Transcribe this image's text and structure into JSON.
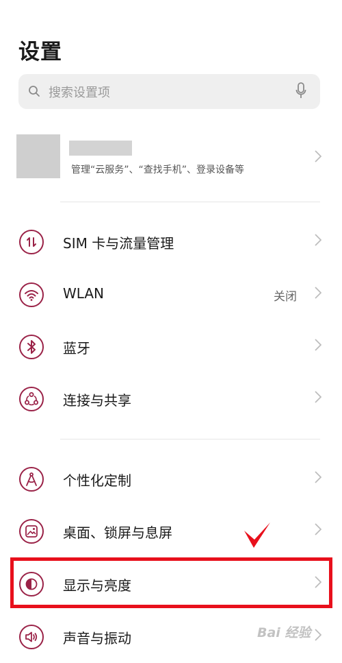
{
  "header": {
    "title": "设置"
  },
  "search": {
    "placeholder": "搜索设置项"
  },
  "account": {
    "subtitle": "管理“云服务”、“查找手机”、登录设备等"
  },
  "items": [
    {
      "label": "SIM 卡与流量管理",
      "icon": "sim-traffic-icon"
    },
    {
      "label": "WLAN",
      "value": "关闭",
      "icon": "wifi-icon"
    },
    {
      "label": "蓝牙",
      "icon": "bluetooth-icon"
    },
    {
      "label": "连接与共享",
      "icon": "share-icon"
    },
    {
      "label": "个性化定制",
      "icon": "personalize-icon"
    },
    {
      "label": "桌面、锁屏与息屏",
      "icon": "wallpaper-icon"
    },
    {
      "label": "显示与亮度",
      "icon": "display-icon"
    },
    {
      "label": "声音与振动",
      "icon": "sound-icon"
    }
  ],
  "watermark": {
    "text": "Bai 经验"
  },
  "colors": {
    "accent": "#9a2247",
    "highlight": "#e8101c"
  }
}
